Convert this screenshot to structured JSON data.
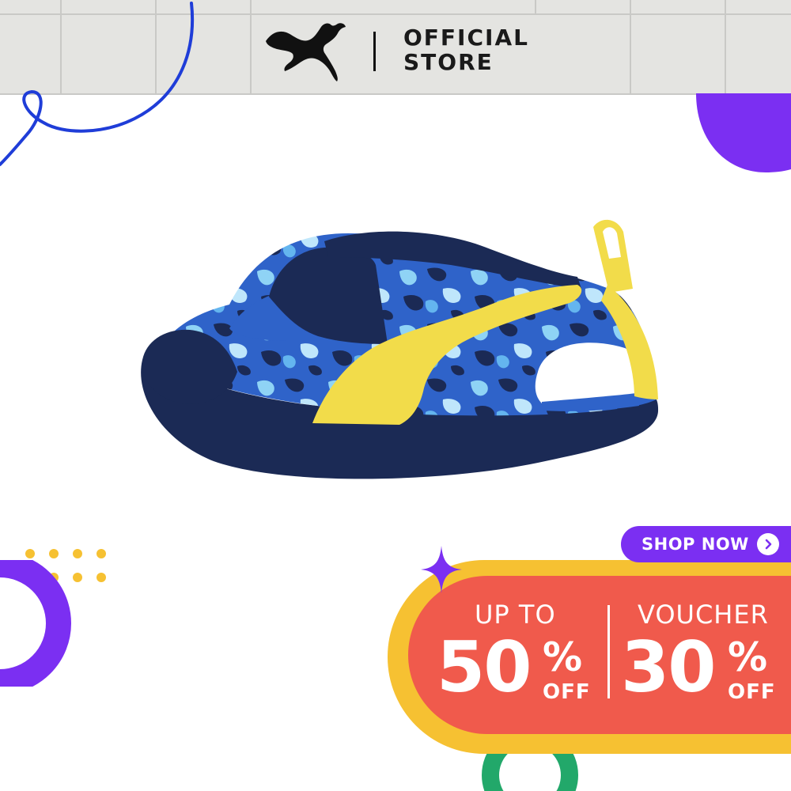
{
  "header": {
    "brand_logo": "puma-cat-logo",
    "store_line1": "OFFICIAL",
    "store_line2": "STORE"
  },
  "product": {
    "image": "kids-sandal-image",
    "colors": {
      "upper": "#1b2a55",
      "accent": "#f2dc4a",
      "camo": "#3a78d6"
    }
  },
  "cta": {
    "label": "SHOP NOW",
    "icon": "chevron-right-icon",
    "color": "#7b2ff2"
  },
  "promo": {
    "left_top": "UP TO",
    "left_value": "50",
    "left_pct": "%",
    "left_off": "OFF",
    "right_top": "VOUCHER",
    "right_value": "30",
    "right_pct": "%",
    "right_off": "OFF",
    "colors": {
      "outer": "#f6c132",
      "inner": "#f05a4c"
    }
  },
  "decor_colors": {
    "purple": "#7b2ff2",
    "blue": "#1f3dd8",
    "yellow": "#f6c132",
    "green": "#22a86a"
  }
}
